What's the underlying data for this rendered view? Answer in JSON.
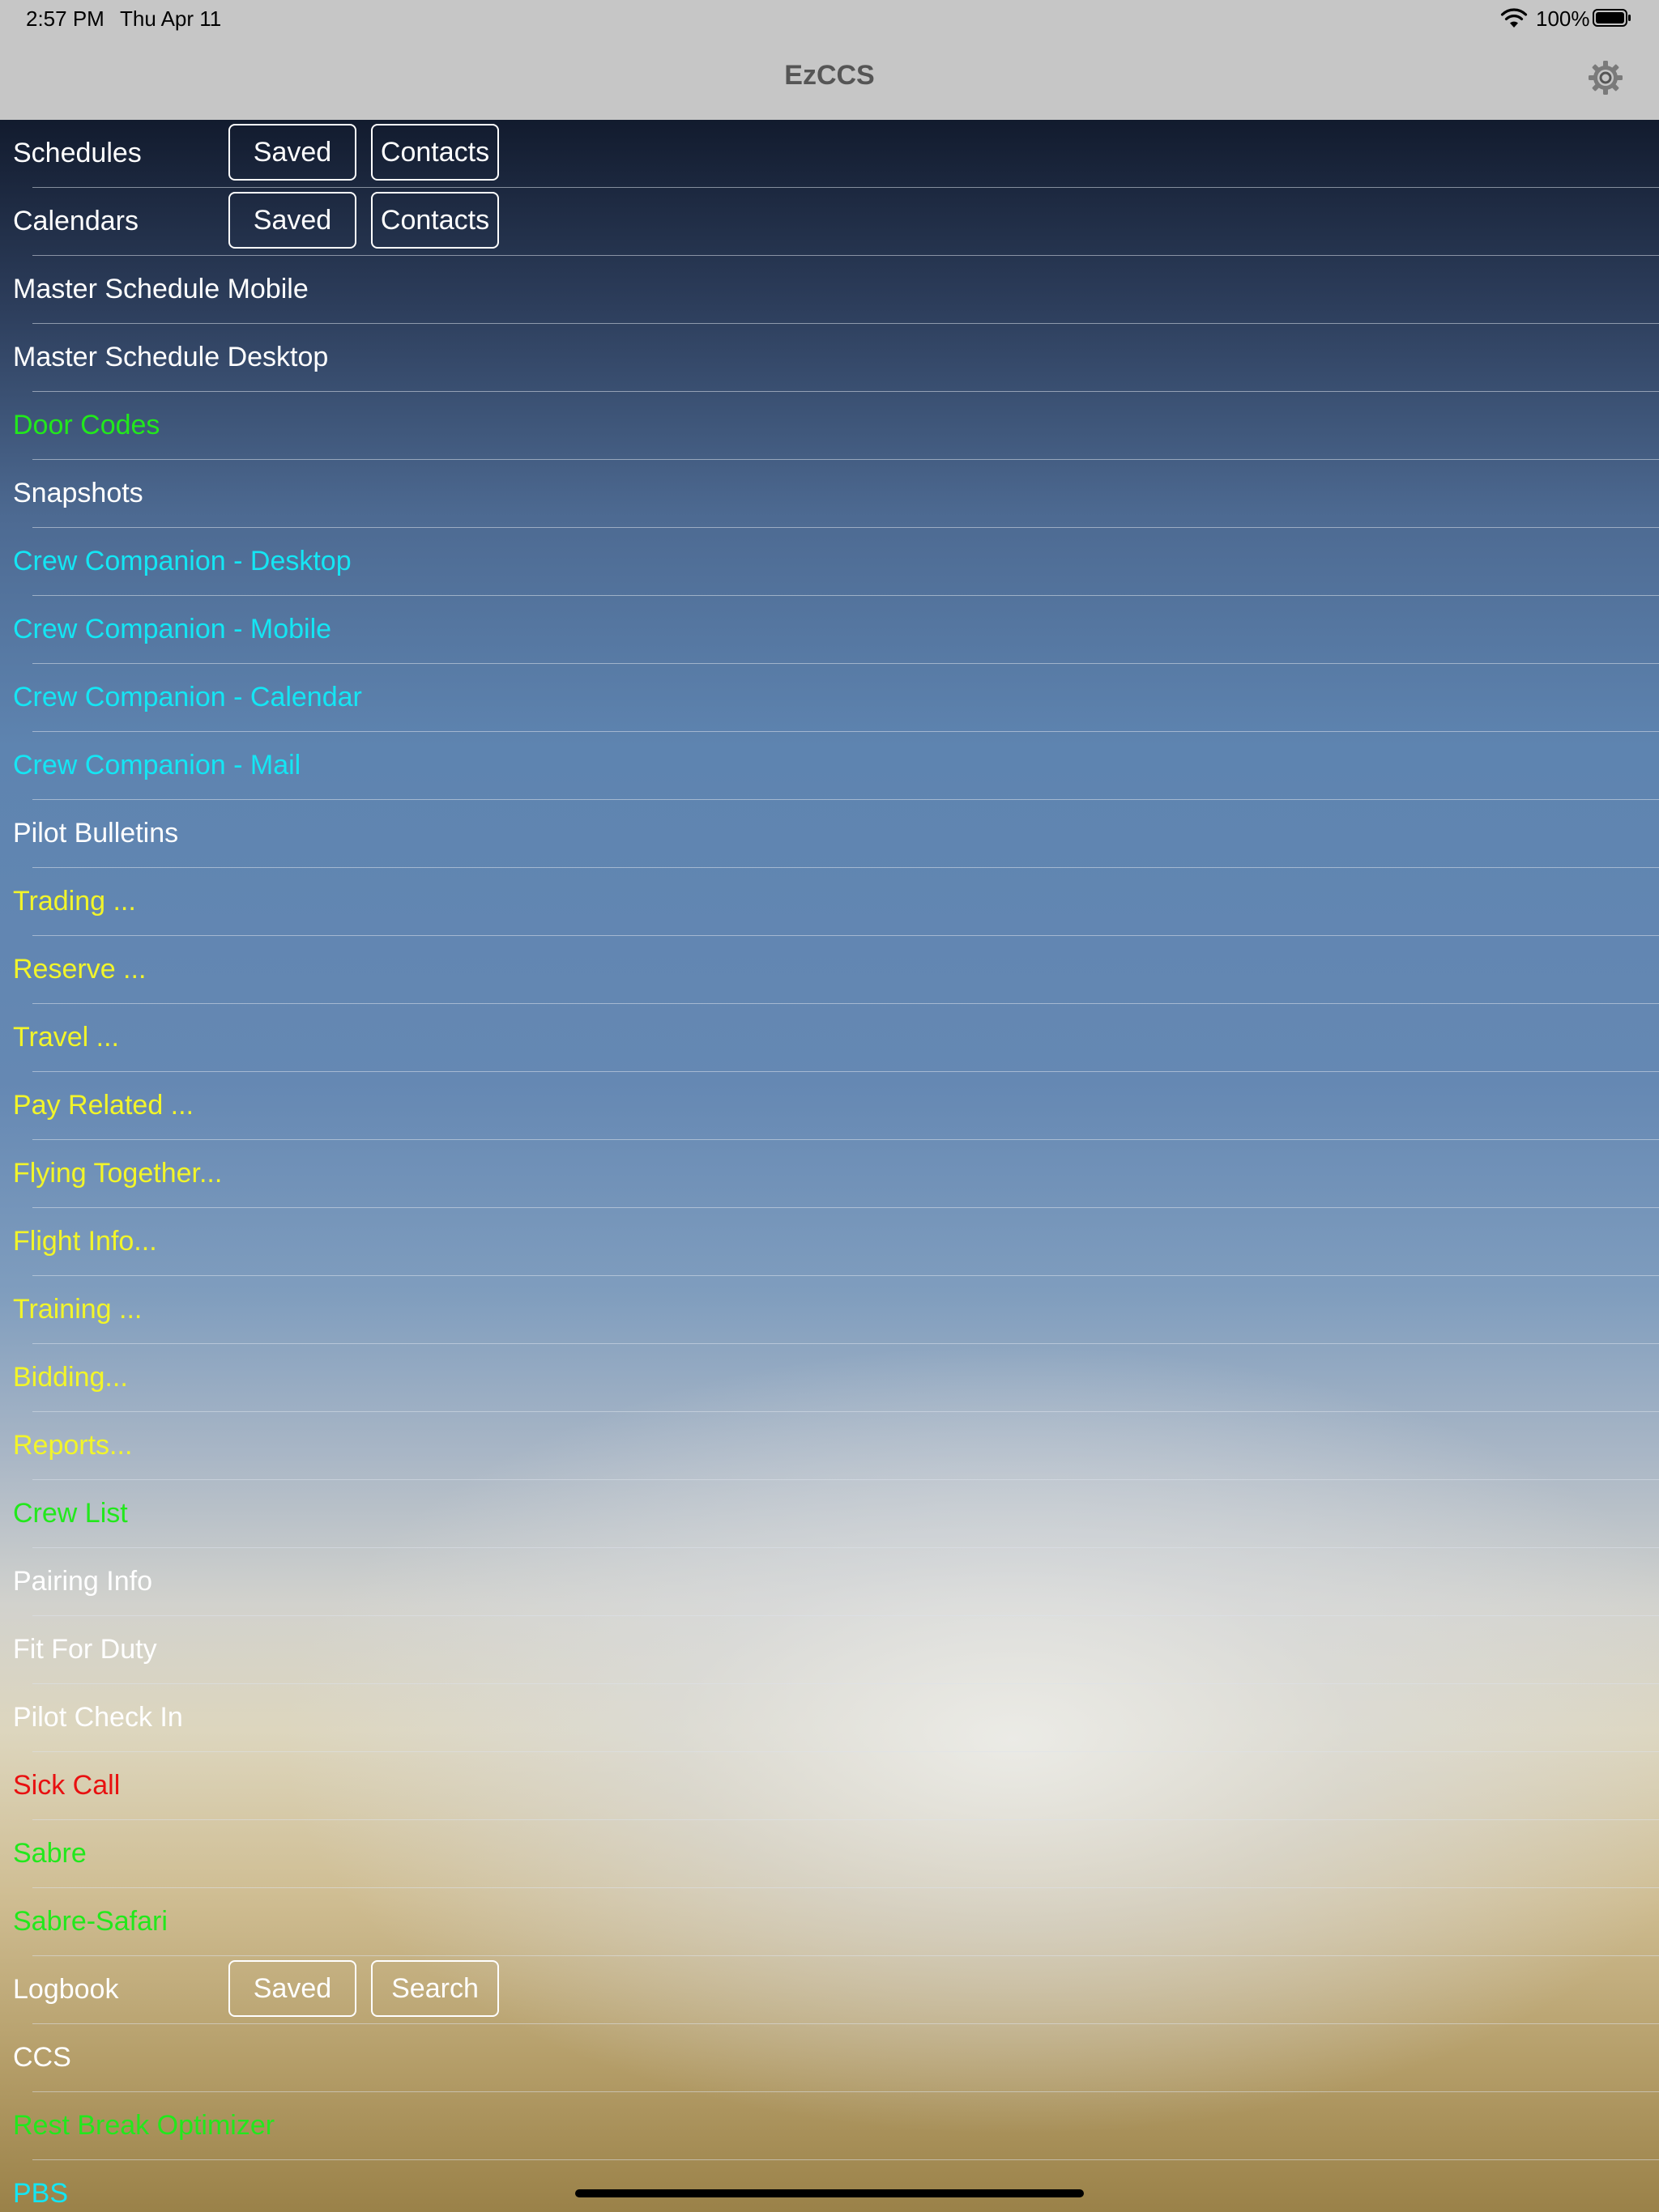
{
  "status_bar": {
    "time": "2:57 PM",
    "date": "Thu Apr 11",
    "battery_percent": "100%",
    "wifi_icon": "wifi-icon",
    "battery_icon": "battery-icon"
  },
  "nav": {
    "title": "EzCCS",
    "settings_icon": "gear-icon"
  },
  "colors": {
    "white": "#ffffff",
    "green": "#22e81c",
    "cyan": "#14e6f4",
    "yellow": "#f2f52a",
    "red": "#e81010"
  },
  "menu": [
    {
      "label": "Schedules",
      "color": "white",
      "buttons": [
        "Saved",
        "Contacts"
      ]
    },
    {
      "label": "Calendars",
      "color": "white",
      "buttons": [
        "Saved",
        "Contacts"
      ]
    },
    {
      "label": "Master Schedule Mobile",
      "color": "white"
    },
    {
      "label": "Master Schedule Desktop",
      "color": "white"
    },
    {
      "label": "Door Codes",
      "color": "green"
    },
    {
      "label": "Snapshots",
      "color": "white"
    },
    {
      "label": "Crew Companion - Desktop",
      "color": "cyan"
    },
    {
      "label": "Crew Companion - Mobile",
      "color": "cyan"
    },
    {
      "label": "Crew Companion - Calendar",
      "color": "cyan"
    },
    {
      "label": "Crew Companion - Mail",
      "color": "cyan"
    },
    {
      "label": "Pilot Bulletins",
      "color": "white"
    },
    {
      "label": "Trading ...",
      "color": "yellow"
    },
    {
      "label": "Reserve ...",
      "color": "yellow"
    },
    {
      "label": "Travel ...",
      "color": "yellow"
    },
    {
      "label": "Pay Related ...",
      "color": "yellow"
    },
    {
      "label": "Flying Together...",
      "color": "yellow"
    },
    {
      "label": "Flight Info...",
      "color": "yellow"
    },
    {
      "label": "Training ...",
      "color": "yellow"
    },
    {
      "label": "Bidding...",
      "color": "yellow"
    },
    {
      "label": "Reports...",
      "color": "yellow"
    },
    {
      "label": "Crew List",
      "color": "green"
    },
    {
      "label": "Pairing Info",
      "color": "white"
    },
    {
      "label": "Fit For Duty",
      "color": "white"
    },
    {
      "label": "Pilot Check In",
      "color": "white"
    },
    {
      "label": "Sick Call",
      "color": "red"
    },
    {
      "label": "Sabre",
      "color": "green"
    },
    {
      "label": "Sabre-Safari",
      "color": "green"
    },
    {
      "label": "Logbook",
      "color": "white",
      "buttons": [
        "Saved",
        "Search"
      ]
    },
    {
      "label": "CCS",
      "color": "white"
    },
    {
      "label": "Rest Break Optimizer",
      "color": "green"
    },
    {
      "label": "PBS",
      "color": "cyan"
    }
  ]
}
